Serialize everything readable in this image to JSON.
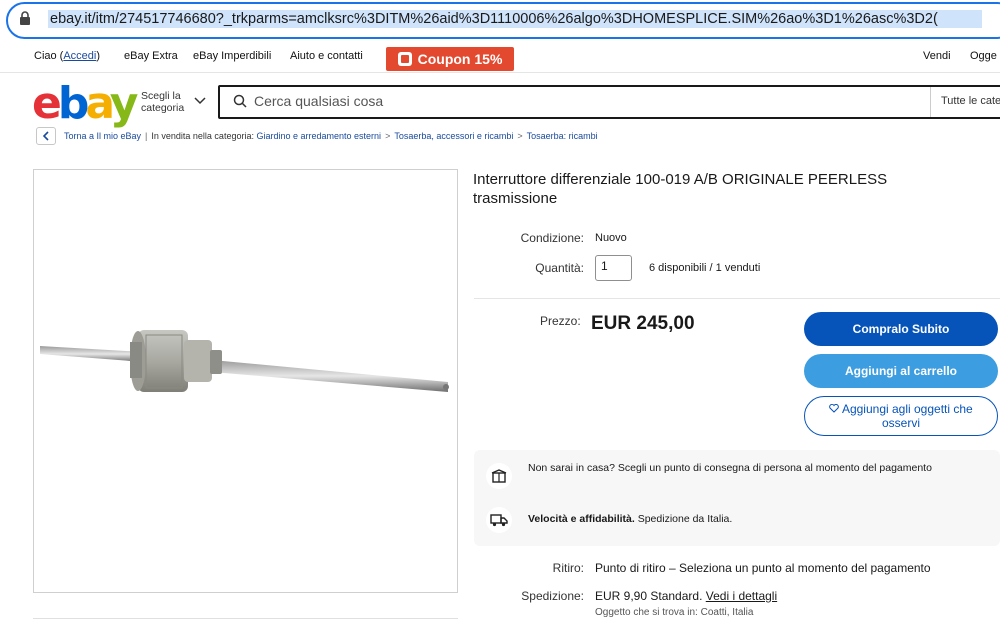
{
  "browser": {
    "url": "ebay.it/itm/274517746680?_trkparms=amclksrc%3DITM%26aid%3D1110006%26algo%3DHOMESPLICE.SIM%26ao%3D1%26asc%3D2("
  },
  "topnav": {
    "greeting": "Ciao (",
    "signin": "Accedi",
    "greeting_end": ")",
    "extra": "eBay Extra",
    "deals": "eBay Imperdibili",
    "help": "Aiuto e contatti",
    "coupon": "Coupon 15%",
    "sell": "Vendi",
    "watch": "Ogge"
  },
  "header": {
    "logo": [
      "e",
      "b",
      "a",
      "y"
    ],
    "category_line1": "Scegli la",
    "category_line2": "categoria",
    "search_placeholder": "Cerca qualsiasi cosa",
    "search_category": "Tutte le cate"
  },
  "breadcrumb": {
    "back": "Torna a Il mio eBay",
    "listed_in": "In vendita nella categoria:",
    "items": [
      "Giardino e arredamento esterni",
      "Tosaerba, accessori e ricambi",
      "Tosaerba: ricambi"
    ]
  },
  "item": {
    "title": "Interruttore differenziale 100-019 A/B ORIGINALE PEERLESS trasmissione",
    "condition_label": "Condizione:",
    "condition_value": "Nuovo",
    "quantity_label": "Quantità:",
    "quantity_value": "1",
    "availability": "6 disponibili / 1 venduti",
    "price_label": "Prezzo:",
    "price_value": "EUR 245,00"
  },
  "actions": {
    "buy_now": "Compralo Subito",
    "add_to_cart": "Aggiungi al carrello",
    "watch": "Aggiungi agli oggetti che osservi"
  },
  "info": {
    "pickup_text": "Non sarai in casa? Scegli un punto di consegna di persona al momento del pagamento",
    "speed_bold": "Velocità e affidabilità.",
    "speed_text": "Spedizione da Italia."
  },
  "shipping": {
    "pickup_label": "Ritiro:",
    "pickup_value": "Punto di ritiro – Seleziona un punto al momento del pagamento",
    "shipping_label": "Spedizione:",
    "shipping_value": "EUR 9,90 Standard.",
    "details_link": "Vedi i dettagli",
    "location": "Oggetto che si trova in: Coatti, Italia"
  },
  "colors": {
    "buy": "#0654ba",
    "cart": "#3c9de0",
    "coupon": "#e2492f"
  }
}
